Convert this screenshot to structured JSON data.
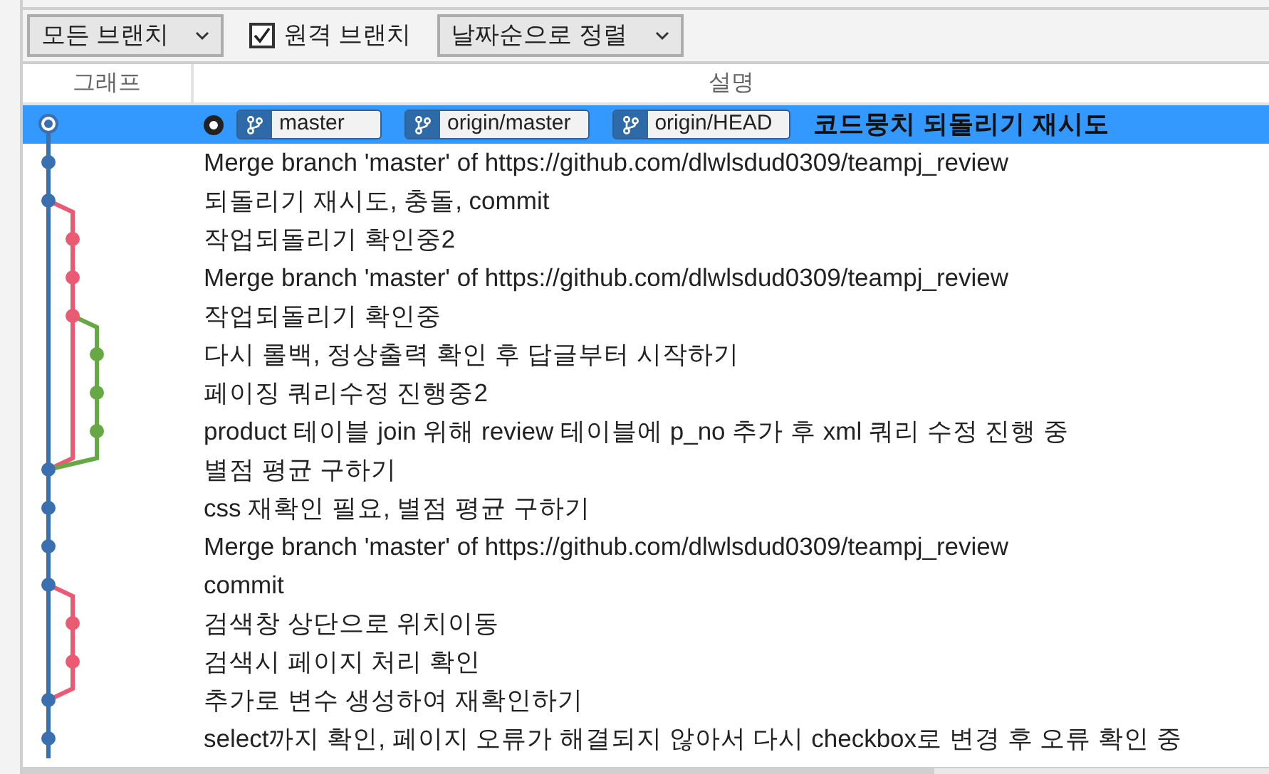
{
  "toolbar": {
    "branch_filter": {
      "value": "모든 브랜치"
    },
    "remote_branches": {
      "label": "원격 브랜치",
      "checked": true
    },
    "sort": {
      "value": "날짜순으로 정렬"
    }
  },
  "columns": [
    "그래프",
    "설명"
  ],
  "commits": [
    {
      "kind": "head",
      "color": "#3a70b0",
      "selected": true,
      "current": true,
      "refs": [
        "master",
        "origin/master",
        "origin/HEAD"
      ],
      "message": "코드뭉치 되돌리기 재시도"
    },
    {
      "kind": "commit",
      "color": "#3a70b0",
      "selected": false,
      "message": "Merge branch 'master' of https://github.com/dlwlsdud0309/teampj_review"
    },
    {
      "kind": "commit",
      "color": "#3a70b0",
      "selected": false,
      "message": "되돌리기 재시도, 충돌, commit"
    },
    {
      "kind": "commit",
      "color": "#ea5a72",
      "selected": false,
      "message": "작업되돌리기 확인중2"
    },
    {
      "kind": "commit",
      "color": "#ea5a72",
      "selected": false,
      "message": "Merge branch 'master' of https://github.com/dlwlsdud0309/teampj_review"
    },
    {
      "kind": "commit",
      "color": "#ea5a72",
      "selected": false,
      "message": "작업되돌리기 확인중"
    },
    {
      "kind": "commit",
      "color": "#65a844",
      "selected": false,
      "message": "다시 롤백, 정상출력 확인 후 답글부터 시작하기"
    },
    {
      "kind": "commit",
      "color": "#65a844",
      "selected": false,
      "message": "페이징 쿼리수정 진행중2"
    },
    {
      "kind": "commit",
      "color": "#65a844",
      "selected": false,
      "message": "product 테이블 join 위해 review 테이블에 p_no 추가 후 xml 쿼리 수정 진행 중"
    },
    {
      "kind": "commit",
      "color": "#3a70b0",
      "selected": false,
      "message": "별점 평균 구하기"
    },
    {
      "kind": "commit",
      "color": "#3a70b0",
      "selected": false,
      "message": "css 재확인 필요, 별점 평균 구하기"
    },
    {
      "kind": "commit",
      "color": "#3a70b0",
      "selected": false,
      "message": "Merge branch 'master' of https://github.com/dlwlsdud0309/teampj_review"
    },
    {
      "kind": "commit",
      "color": "#3a70b0",
      "selected": false,
      "message": "commit"
    },
    {
      "kind": "commit",
      "color": "#ea5a72",
      "selected": false,
      "message": "검색창 상단으로 위치이동"
    },
    {
      "kind": "commit",
      "color": "#ea5a72",
      "selected": false,
      "message": "검색시 페이지 처리 확인"
    },
    {
      "kind": "commit",
      "color": "#3a70b0",
      "selected": false,
      "message": "추가로 변수 생성하여 재확인하기"
    },
    {
      "kind": "commit",
      "color": "#3a70b0",
      "selected": false,
      "message": "select까지 확인, 페이지 오류가 해결되지 않아서 다시 checkbox로 변경 후 오류 확인 중"
    }
  ]
}
